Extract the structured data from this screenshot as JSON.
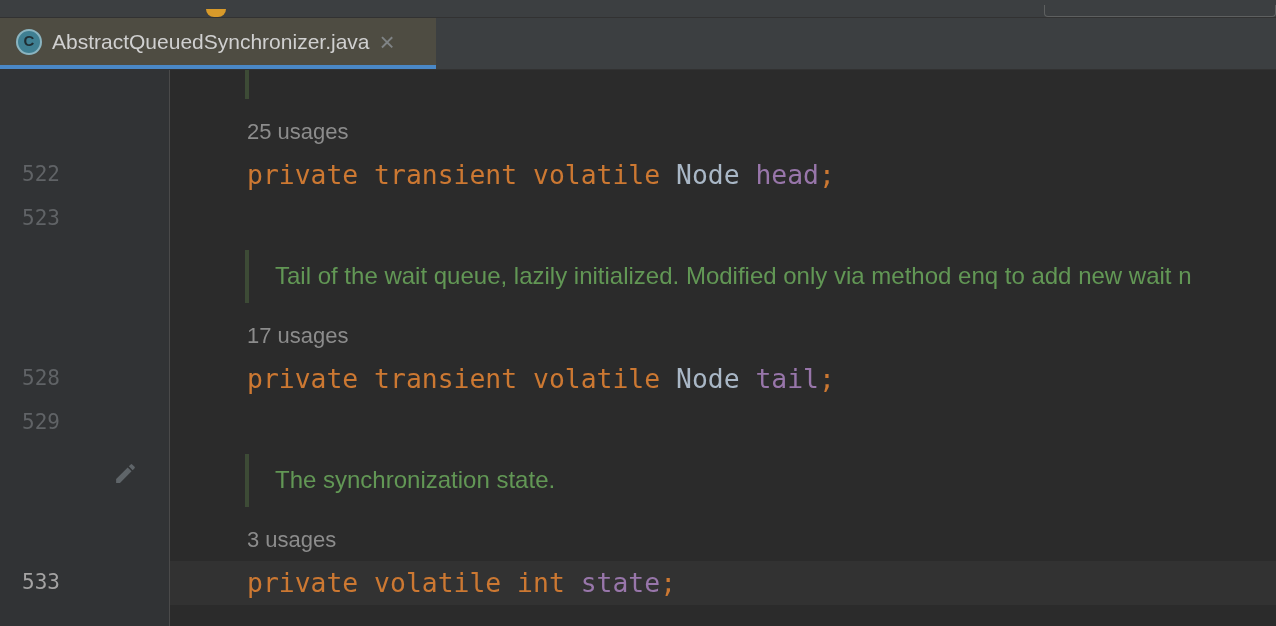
{
  "tab": {
    "icon_letter": "C",
    "title": "AbstractQueuedSynchronizer.java",
    "close": "×",
    "selected": true
  },
  "rows": [
    {
      "kind": "doc_cut"
    },
    {
      "kind": "usages",
      "text": "25 usages"
    },
    {
      "kind": "code",
      "number": "522",
      "current": false,
      "tokens": [
        {
          "text": "private ",
          "kind": "keyword"
        },
        {
          "text": "transient ",
          "kind": "keyword"
        },
        {
          "text": "volatile ",
          "kind": "keyword"
        },
        {
          "text": "Node ",
          "kind": "type"
        },
        {
          "text": "head",
          "kind": "field"
        },
        {
          "text": ";",
          "kind": "keyword"
        }
      ]
    },
    {
      "kind": "code",
      "number": "523",
      "current": false,
      "tokens": []
    },
    {
      "kind": "doc",
      "text": "Tail of the wait queue, lazily initialized. Modified only via method enq to add new wait n"
    },
    {
      "kind": "usages",
      "text": "17 usages"
    },
    {
      "kind": "code",
      "number": "528",
      "current": false,
      "tokens": [
        {
          "text": "private ",
          "kind": "keyword"
        },
        {
          "text": "transient ",
          "kind": "keyword"
        },
        {
          "text": "volatile ",
          "kind": "keyword"
        },
        {
          "text": "Node ",
          "kind": "type"
        },
        {
          "text": "tail",
          "kind": "field"
        },
        {
          "text": ";",
          "kind": "keyword"
        }
      ]
    },
    {
      "kind": "code",
      "number": "529",
      "current": false,
      "tokens": []
    },
    {
      "kind": "doc",
      "text": "The synchronization state.",
      "edit_icon": true
    },
    {
      "kind": "usages",
      "text": "3 usages"
    },
    {
      "kind": "code",
      "number": "533",
      "current": true,
      "tokens": [
        {
          "text": "private ",
          "kind": "keyword"
        },
        {
          "text": "volatile ",
          "kind": "keyword"
        },
        {
          "text": "int ",
          "kind": "keyword"
        },
        {
          "text": "state",
          "kind": "field"
        },
        {
          "text": ";",
          "kind": "keyword"
        }
      ]
    }
  ]
}
